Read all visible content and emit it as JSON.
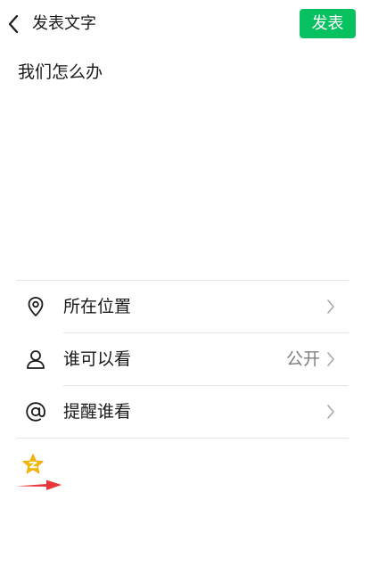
{
  "header": {
    "title": "发表文字",
    "publish_label": "发表"
  },
  "post": {
    "text": "我们怎么办"
  },
  "options": {
    "location": {
      "label": "所在位置",
      "icon": "location-pin-icon"
    },
    "visibility": {
      "label": "谁可以看",
      "value": "公开",
      "icon": "person-icon"
    },
    "mention": {
      "label": "提醒谁看",
      "icon": "at-sign-icon"
    }
  },
  "share": {
    "icon": "qzone-star-icon"
  },
  "colors": {
    "accent": "#07c160",
    "divider": "#e6e6e6",
    "arrow": "#e8363a",
    "qzone": "#f5b800"
  }
}
